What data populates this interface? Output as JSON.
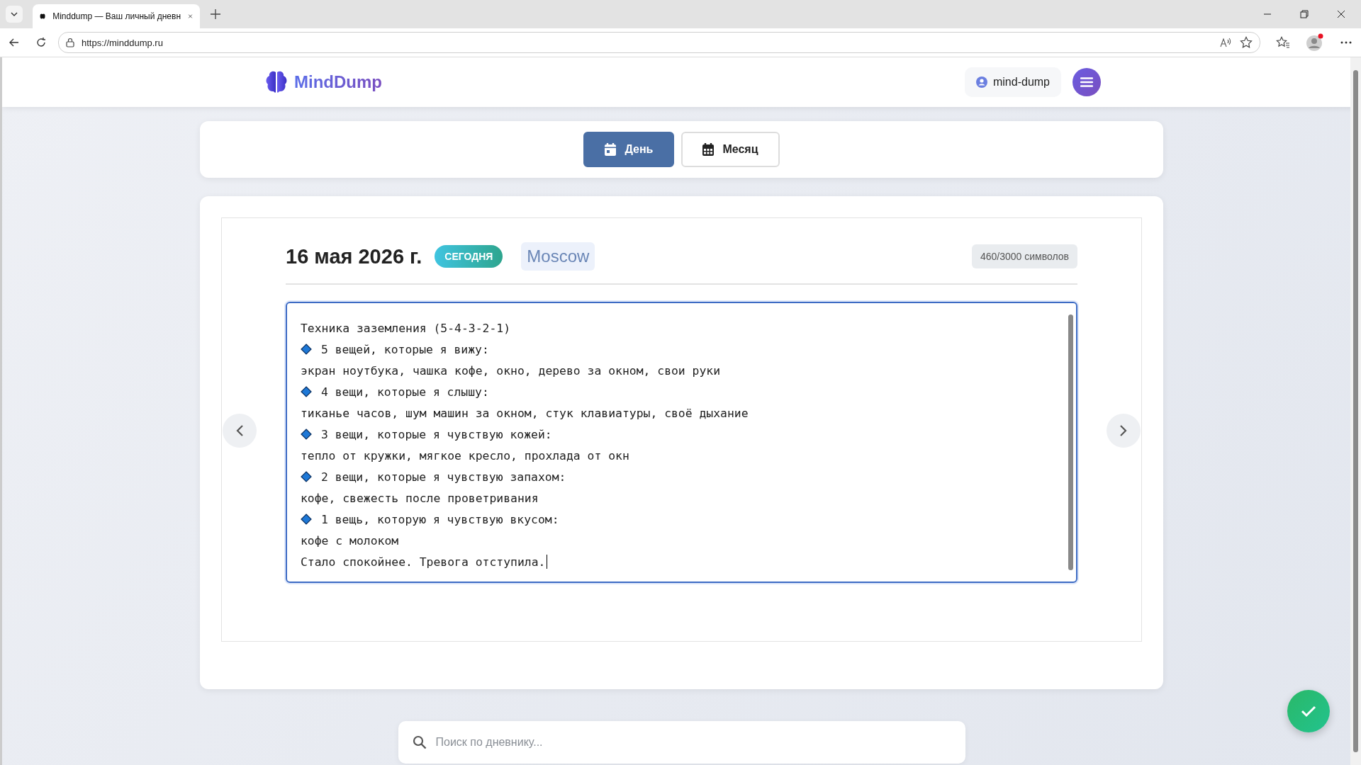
{
  "browser": {
    "tab": {
      "title": "Minddump — Ваш личный дневн",
      "selected": true
    },
    "url": "https://minddump.ru"
  },
  "header": {
    "logo": "MindDump",
    "user": "mind-dump"
  },
  "view_tabs": [
    {
      "label": "День",
      "kind": "day",
      "selected": true
    },
    {
      "label": "Месяц",
      "kind": "month",
      "selected": false
    }
  ],
  "entry": {
    "date": "16 мая 2026 г.",
    "badge": "СЕГОДНЯ",
    "city": "Moscow",
    "counter": "460/3000 символов",
    "lines": [
      {
        "kind": "text",
        "text": "Техника заземления (5-4-3-2-1)"
      },
      {
        "kind": "item",
        "text": "5 вещей, которые я вижу:"
      },
      {
        "kind": "text",
        "text": "экран ноутбука, чашка кофе, окно, дерево за окном, свои руки"
      },
      {
        "kind": "item",
        "text": "4 вещи, которые я слышу:"
      },
      {
        "kind": "text",
        "text": "тиканье часов, шум машин за окном, стук клавиатуры, своё дыхание"
      },
      {
        "kind": "item",
        "text": "3 вещи, которые я чувствую кожей:"
      },
      {
        "kind": "text",
        "text": "тепло от кружки, мягкое кресло, прохлада от окн"
      },
      {
        "kind": "item",
        "text": "2 вещи, которые я чувствую запахом:"
      },
      {
        "kind": "text",
        "text": "кофе, свежесть после проветривания"
      },
      {
        "kind": "item",
        "text": "1 вещь, которую я чувствую вкусом:"
      },
      {
        "kind": "text",
        "text": "кофе с молоком"
      },
      {
        "kind": "text",
        "text": "Стало спокойнее. Тревога отступила."
      }
    ]
  },
  "search": {
    "placeholder": "Поиск по дневнику..."
  }
}
